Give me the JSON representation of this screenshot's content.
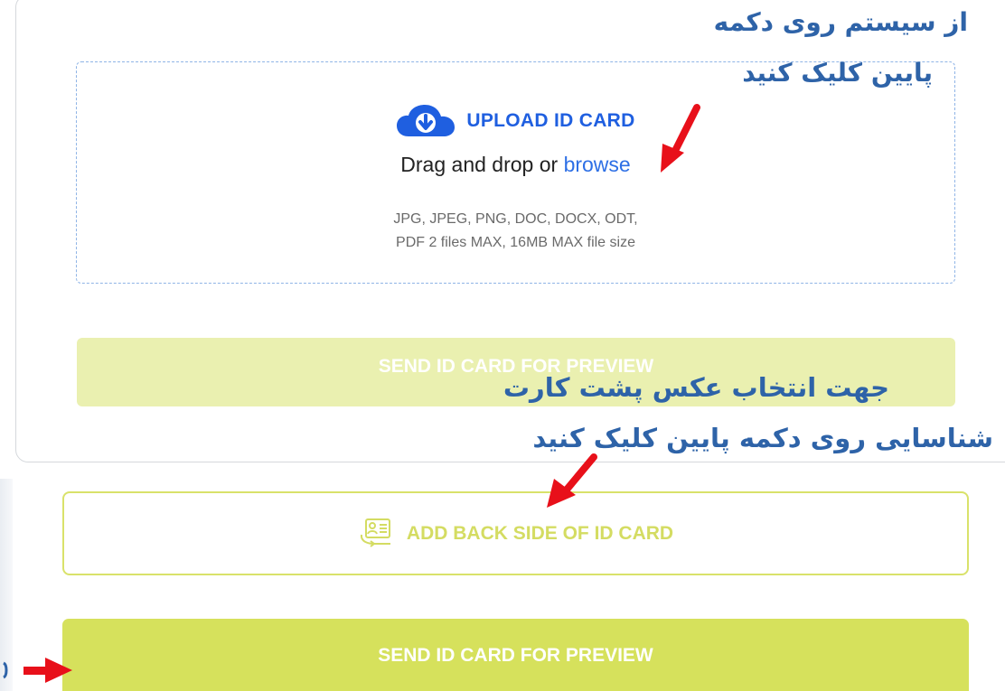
{
  "upload": {
    "title": "UPLOAD ID CARD",
    "drag_text": "Drag and drop or ",
    "browse_link": "browse",
    "hint_line1": "JPG, JPEG, PNG, DOC, DOCX, ODT,",
    "hint_line2": "PDF 2 files MAX, 16MB MAX file size"
  },
  "buttons": {
    "send_disabled_label": "SEND ID CARD FOR PREVIEW",
    "add_back_label": "ADD BACK SIDE OF ID CARD",
    "send_label": "SEND ID CARD FOR PREVIEW"
  },
  "annotations": {
    "first_line1": "از سیستم روی دکمه",
    "first_line2": "پایین کلیک کنید",
    "second_line1": "جهت انتخاب عکس پشت کارت",
    "second_line2": "شناسایی روی دکمه پایین کلیک کنید"
  },
  "icons": {
    "upload": "cloud-download-icon",
    "back_side": "id-card-icon",
    "pointer": "red-arrow-icon"
  },
  "colors": {
    "upload_blue": "#1f5fe0",
    "link_blue": "#2d6fe5",
    "button_green": "#d6e15c",
    "button_green_disabled": "#eaf0b0",
    "annotation_blue": "#2e63a8",
    "arrow_red": "#e8101a"
  }
}
